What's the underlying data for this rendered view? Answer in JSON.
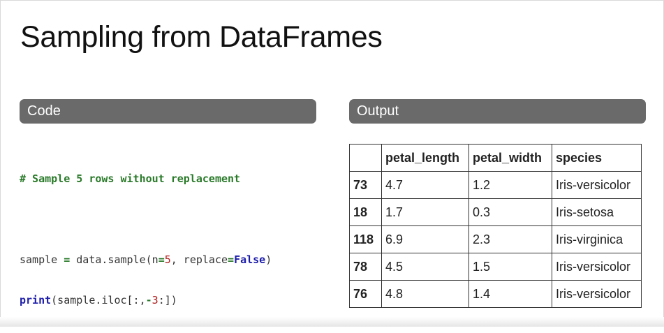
{
  "slide": {
    "title": "Sampling from DataFrames"
  },
  "code_panel": {
    "header": "Code",
    "comment": "# Sample 5 rows without replacement",
    "line2": {
      "a": "sample ",
      "eq": "=",
      "b": " data.sample(n",
      "eq2": "=",
      "n": "5",
      "c": ", replace",
      "eq3": "=",
      "val": "False",
      "d": ")"
    },
    "line3": {
      "kw": "print",
      "a": "(sample.iloc[:,",
      "neg": "-",
      "num": "3",
      "b": ":])"
    }
  },
  "output_panel": {
    "header": "Output",
    "columns": [
      "",
      "petal_length",
      "petal_width",
      "species"
    ],
    "rows": [
      [
        "73",
        "4.7",
        "1.2",
        "Iris-versicolor"
      ],
      [
        "18",
        "1.7",
        "0.3",
        "Iris-setosa"
      ],
      [
        "118",
        "6.9",
        "2.3",
        "Iris-virginica"
      ],
      [
        "78",
        "4.5",
        "1.5",
        "Iris-versicolor"
      ],
      [
        "76",
        "4.8",
        "1.4",
        "Iris-versicolor"
      ]
    ]
  }
}
